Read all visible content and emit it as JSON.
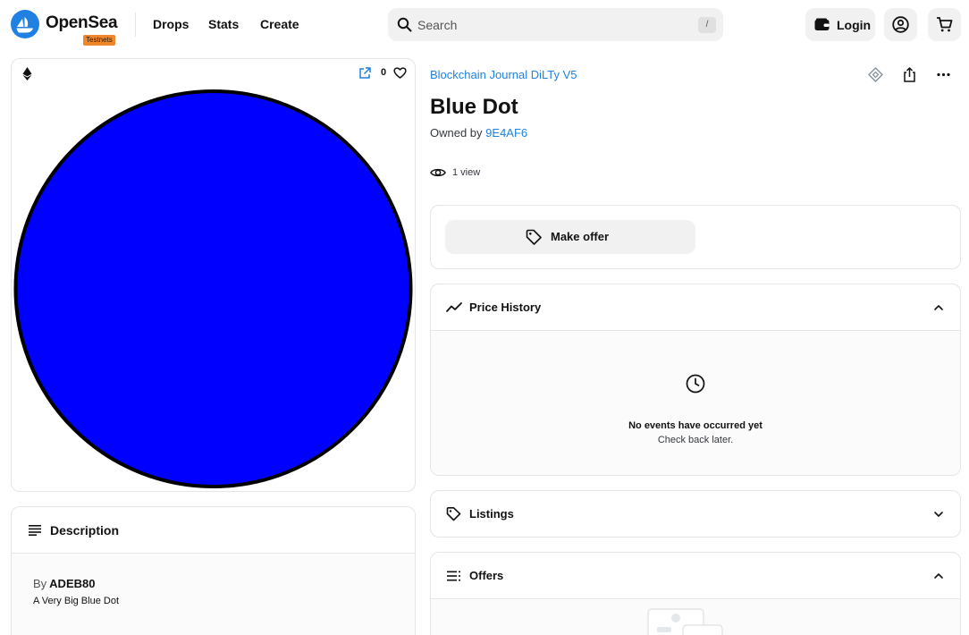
{
  "header": {
    "brand": "OpenSea",
    "badge": "Testnets",
    "nav": [
      "Drops",
      "Stats",
      "Create"
    ],
    "search_placeholder": "Search",
    "search_shortcut": "/",
    "login_label": "Login"
  },
  "media": {
    "favorites_count": "0",
    "image_fill": "#0000ff",
    "image_stroke": "#000000"
  },
  "description": {
    "title": "Description",
    "by_prefix": "By",
    "author": "ADEB80",
    "text": "A Very Big Blue Dot"
  },
  "item": {
    "collection": "Blockchain Journal DiLTy V5",
    "name": "Blue Dot",
    "owned_by_prefix": "Owned by",
    "owner": "9E4AF6",
    "views": "1 view"
  },
  "offer": {
    "make_offer_label": "Make offer"
  },
  "price_history": {
    "title": "Price History",
    "empty_title": "No events have occurred yet",
    "empty_subtitle": "Check back later."
  },
  "listings": {
    "title": "Listings"
  },
  "offers": {
    "title": "Offers"
  },
  "colors": {
    "accent_link": "#2081e2",
    "badge": "#f1872b",
    "logo": "#2081e2"
  }
}
